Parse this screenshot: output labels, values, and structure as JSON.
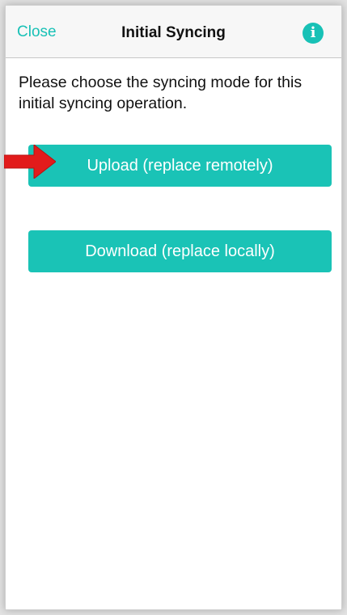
{
  "navbar": {
    "close_label": "Close",
    "title": "Initial Syncing",
    "info_icon_glyph": "i"
  },
  "content": {
    "prompt": "Please choose the syncing mode for this initial syncing operation."
  },
  "buttons": {
    "upload_label": "Upload (replace remotely)",
    "download_label": "Download (replace locally)"
  },
  "colors": {
    "accent": "#1ac3b6",
    "arrow": "#e21b1b"
  },
  "icons": {
    "info": "info-icon",
    "arrow": "red-arrow-indicator"
  }
}
